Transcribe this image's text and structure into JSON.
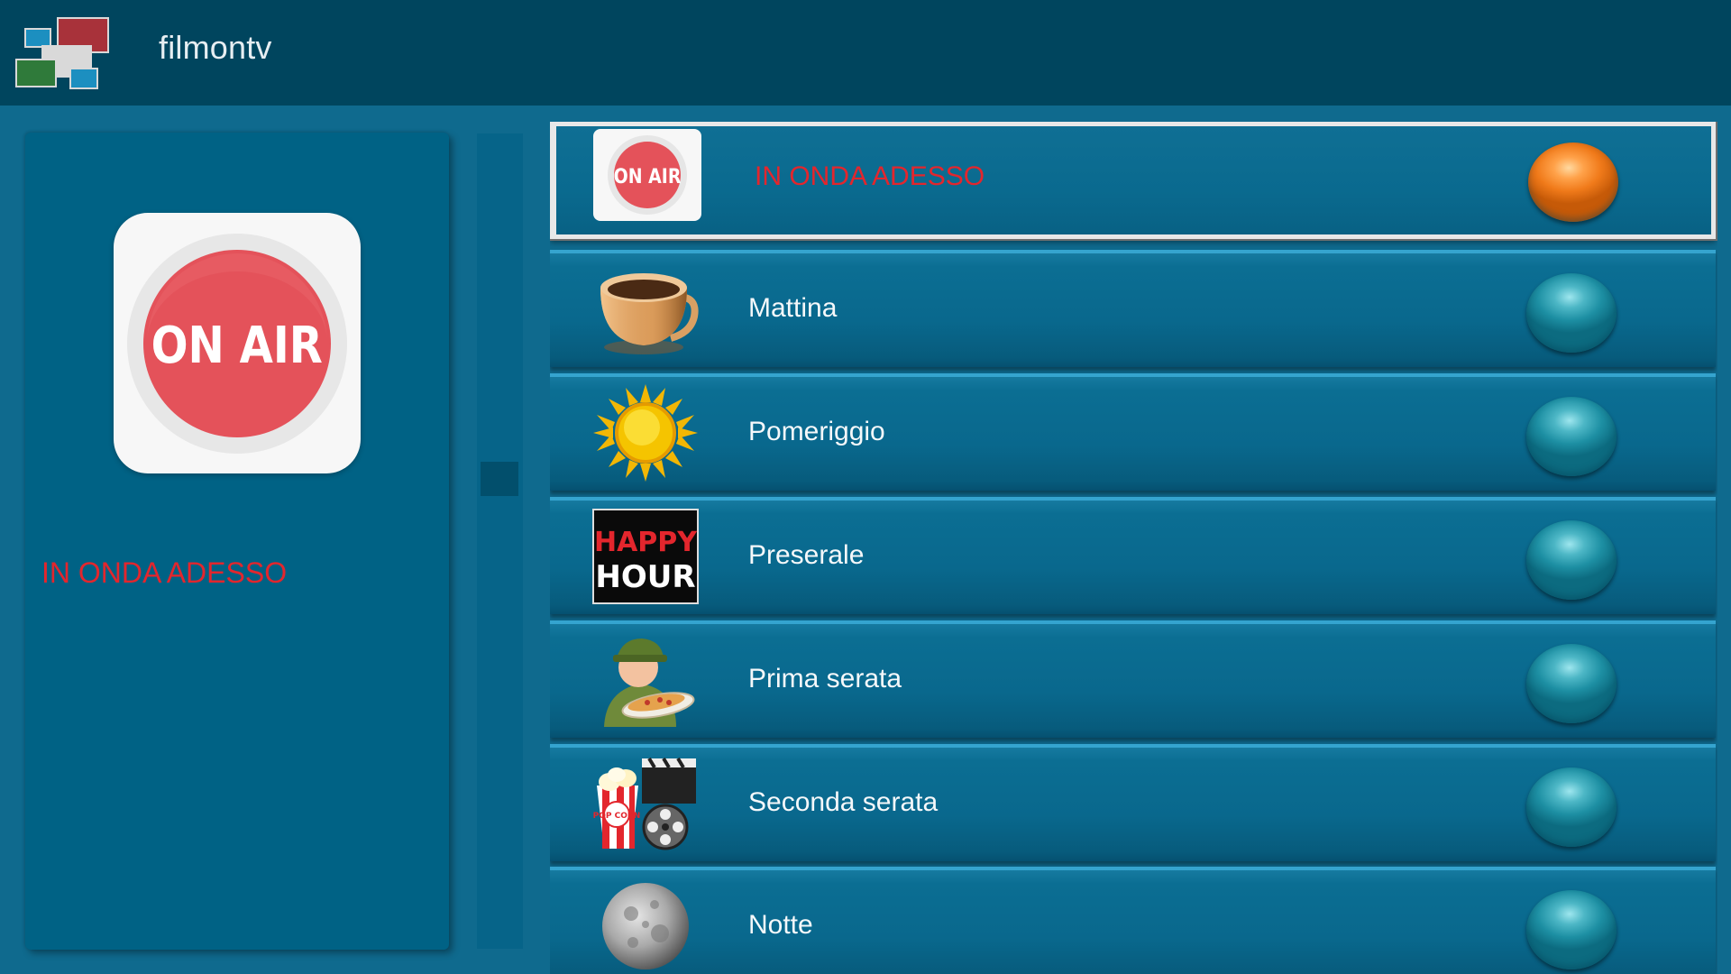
{
  "app": {
    "title": "filmontv"
  },
  "detail": {
    "badge_text": "ON AIR",
    "title": "IN ONDA ADESSO"
  },
  "list": {
    "items": [
      {
        "label": "IN ONDA ADESSO",
        "icon": "on-air-icon",
        "selected": true
      },
      {
        "label": "Mattina",
        "icon": "coffee-cup-icon",
        "selected": false
      },
      {
        "label": "Pomeriggio",
        "icon": "sun-icon",
        "selected": false
      },
      {
        "label": "Preserale",
        "icon": "happy-hour-icon",
        "icon_text": [
          "HAPPY",
          "HOUR"
        ],
        "selected": false
      },
      {
        "label": "Prima serata",
        "icon": "pizza-delivery-icon",
        "selected": false
      },
      {
        "label": "Seconda serata",
        "icon": "popcorn-film-icon",
        "icon_text": "POP CORN",
        "selected": false
      },
      {
        "label": "Notte",
        "icon": "moon-icon",
        "selected": false
      }
    ]
  },
  "colors": {
    "topbar": "#00455e",
    "background": "#0f6a8e",
    "panel": "#006285",
    "accent_red": "#e3262d",
    "selected_radio": "#f07a1a",
    "radio": "#1d8fa3"
  }
}
